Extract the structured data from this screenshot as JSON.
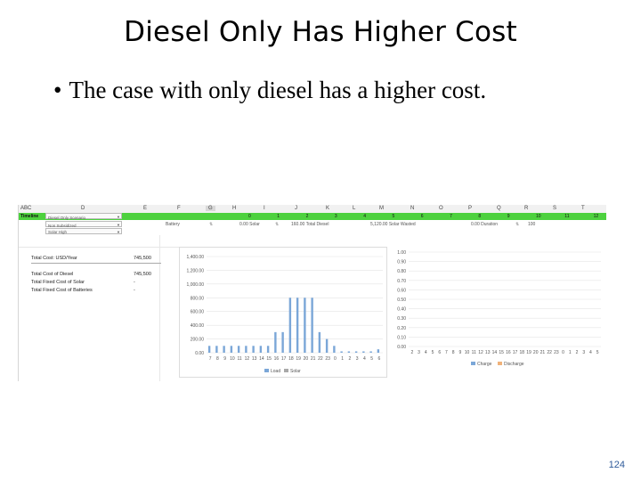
{
  "slide": {
    "title": "Diesel Only Has Higher Cost",
    "bullet_mark": "•",
    "bullet": "The case with only diesel has a higher cost.",
    "page_number": "124"
  },
  "sheet": {
    "column_headers": [
      "A",
      "B",
      "C",
      "D",
      "E",
      "F",
      "G",
      "H",
      "I",
      "J",
      "K",
      "L",
      "M",
      "N",
      "O",
      "P",
      "Q",
      "R",
      "S",
      "T"
    ],
    "selected_column": "G",
    "timeline_label": "Timeline",
    "dropdowns": [
      "Diesel Only Scenario",
      "Non Subsidized",
      "Solar High"
    ],
    "timeline_numbers": [
      "0",
      "1",
      "2",
      "3",
      "4",
      "5",
      "6",
      "7",
      "8",
      "9",
      "10",
      "11",
      "12"
    ],
    "row2": {
      "battery_label": "Battery",
      "solar_value": "0.00 Solar",
      "diesel_value": "160.00 Total Diesel",
      "wasted_value": "5,120.00 Solar Wasted",
      "duration_value": "0.00 Duration",
      "last_value": "100"
    },
    "summary": [
      {
        "label": "Total Cost: USD/Year",
        "value": "745,500"
      },
      {
        "label": "Total Cost of Diesel",
        "value": "745,500"
      },
      {
        "label": "Total Fixed Cost of Solar",
        "value": "-"
      },
      {
        "label": "Total Fixed Cost of Batteries",
        "value": "-"
      }
    ]
  },
  "chart_data": [
    {
      "type": "bar",
      "title": "",
      "categories": [
        "7",
        "8",
        "9",
        "10",
        "11",
        "12",
        "13",
        "14",
        "15",
        "16",
        "17",
        "18",
        "19",
        "20",
        "21",
        "22",
        "23",
        "0",
        "1",
        "2",
        "3",
        "4",
        "5",
        "6"
      ],
      "series": [
        {
          "name": "Load",
          "values": [
            100,
            100,
            100,
            100,
            100,
            100,
            100,
            100,
            100,
            300,
            300,
            800,
            800,
            800,
            800,
            300,
            200,
            100,
            20,
            20,
            20,
            20,
            20,
            50
          ]
        },
        {
          "name": "Solar",
          "values": [
            0,
            0,
            0,
            0,
            0,
            0,
            0,
            0,
            0,
            0,
            0,
            0,
            0,
            0,
            0,
            0,
            0,
            0,
            0,
            0,
            0,
            0,
            0,
            0
          ]
        }
      ],
      "y_ticks": [
        "0.00",
        "200.00",
        "400.00",
        "600.00",
        "800.00",
        "1,000.00",
        "1,200.00",
        "1,400.00"
      ],
      "ylim": [
        0,
        1400
      ],
      "legend": "bottom",
      "grid": true,
      "colors": {
        "Load": "#7ba7d8",
        "Solar": "#a9a9a9"
      }
    },
    {
      "type": "bar",
      "title": "",
      "categories": [
        "2",
        "3",
        "4",
        "5",
        "6",
        "7",
        "8",
        "9",
        "10",
        "11",
        "12",
        "13",
        "14",
        "15",
        "16",
        "17",
        "18",
        "19",
        "20",
        "21",
        "22",
        "23",
        "0",
        "1",
        "2",
        "3",
        "4",
        "5"
      ],
      "series": [
        {
          "name": "Charge",
          "values": []
        },
        {
          "name": "Discharge",
          "values": []
        }
      ],
      "y_ticks": [
        "0.00",
        "0.10",
        "0.20",
        "0.30",
        "0.40",
        "0.50",
        "0.60",
        "0.70",
        "0.80",
        "0.90",
        "1.00"
      ],
      "ylim": [
        0,
        1
      ],
      "legend": "bottom",
      "grid": true,
      "colors": {
        "Charge": "#7ba7d8",
        "Discharge": "#f0b27a"
      }
    }
  ]
}
